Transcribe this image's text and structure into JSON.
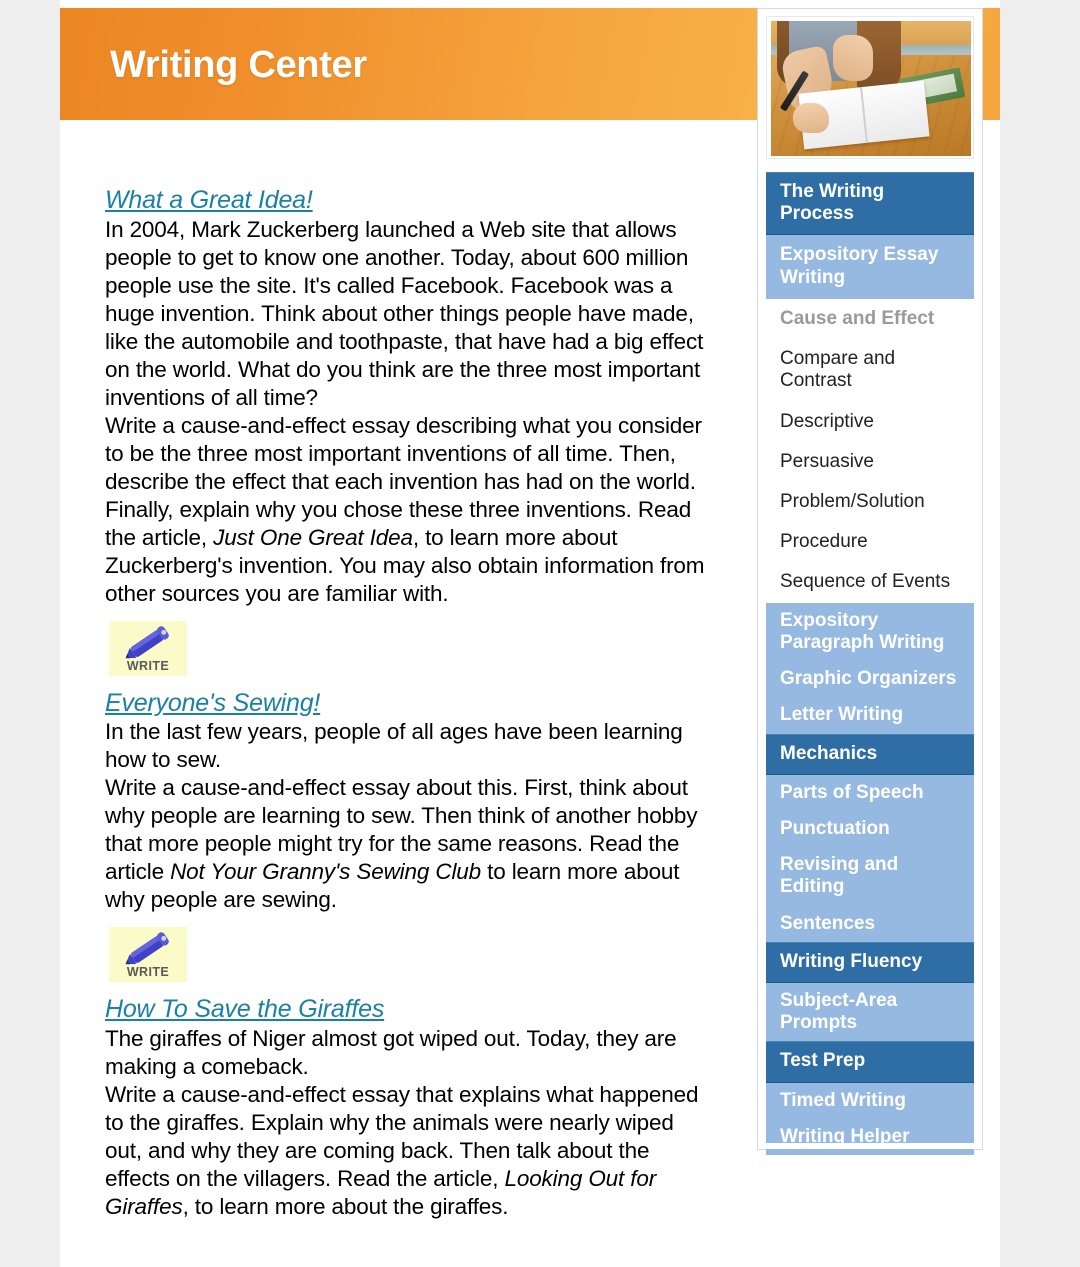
{
  "header": {
    "title": "Writing Center",
    "accent_color": "#f3a23c"
  },
  "photo": {
    "alt": "girl-writing-in-notebook-photo"
  },
  "sidebar": {
    "items": [
      {
        "label": "The Writing Process",
        "style": "section"
      },
      {
        "label": "Expository Essay Writing",
        "style": "sub-selected"
      },
      {
        "label": "Cause and Effect",
        "style": "plain-current"
      },
      {
        "label": "Compare and Contrast",
        "style": "plain"
      },
      {
        "label": "Descriptive",
        "style": "plain"
      },
      {
        "label": "Persuasive",
        "style": "plain"
      },
      {
        "label": "Problem/Solution",
        "style": "plain"
      },
      {
        "label": "Procedure",
        "style": "plain"
      },
      {
        "label": "Sequence of Events",
        "style": "plain"
      },
      {
        "label": "Expository Paragraph Writing",
        "style": "sub"
      },
      {
        "label": "Graphic Organizers",
        "style": "sub"
      },
      {
        "label": "Letter Writing",
        "style": "sub"
      },
      {
        "label": "Mechanics",
        "style": "section"
      },
      {
        "label": "Parts of Speech",
        "style": "sub"
      },
      {
        "label": "Punctuation",
        "style": "sub"
      },
      {
        "label": "Revising and Editing",
        "style": "sub"
      },
      {
        "label": "Sentences",
        "style": "sub"
      },
      {
        "label": "Writing Fluency",
        "style": "section"
      },
      {
        "label": "Subject-Area Prompts",
        "style": "sub"
      },
      {
        "label": "Test Prep",
        "style": "section"
      },
      {
        "label": "Timed Writing",
        "style": "sub"
      },
      {
        "label": "Writing Helper",
        "style": "sub"
      }
    ],
    "colors": {
      "section_bg": "#2f6ea5",
      "sub_bg": "#96b9e2",
      "current_text": "#9a9a9a"
    }
  },
  "main": {
    "entries": [
      {
        "title": "What a Great Idea!",
        "intro": "In 2004, Mark Zuckerberg launched a Web site that allows people to get to know one another. Today, about 600 million people use the site. It's called Facebook. Facebook was a huge invention. Think about other things people have made, like the automobile and toothpaste, that have had a big effect on the world. What do you think are the three most important inventions of all time?",
        "prompt_pre": "Write a cause-and-effect essay describing what you consider to be the three most important inventions of all time. Then, describe the effect that each invention has had on the world. Finally, explain why you chose these three inventions. Read the article, ",
        "prompt_italic": "Just One Great Idea",
        "prompt_post": ", to learn more about Zuckerberg's invention. You may also obtain information from other sources you are familiar with.",
        "write_label": "WRITE"
      },
      {
        "title": "Everyone's Sewing!",
        "intro": "In the last few years, people of all ages have been learning how to sew.",
        "prompt_pre": "Write a cause-and-effect essay about this. First, think about why people are learning to sew. Then think of another hobby that more people might try for the same reasons. Read the article ",
        "prompt_italic": "Not Your Granny's Sewing Club",
        "prompt_post": " to learn more about why people are sewing.",
        "write_label": "WRITE"
      },
      {
        "title": "How To Save the Giraffes",
        "intro": "The giraffes of Niger almost got wiped out. Today, they are making a comeback.",
        "prompt_pre": "Write a cause-and-effect essay that explains what happened to the giraffes. Explain why the animals were nearly wiped out, and why they are coming back. Then talk about the effects on the villagers. Read the article, ",
        "prompt_italic": "Looking Out for Giraffes",
        "prompt_post": ", to learn more about the giraffes.",
        "write_label": ""
      }
    ],
    "link_color": "#1981a6"
  }
}
